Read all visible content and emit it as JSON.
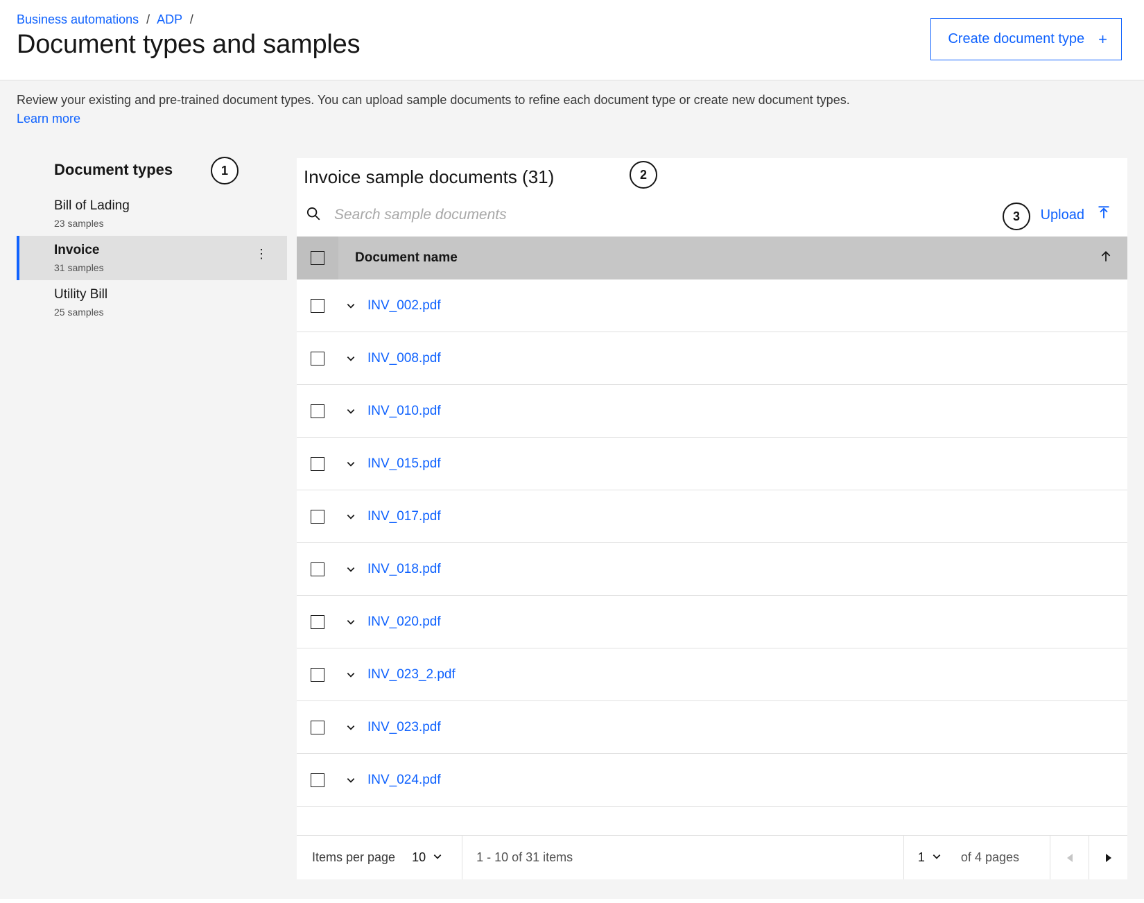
{
  "breadcrumb": {
    "item1": "Business automations",
    "item2": "ADP"
  },
  "pageTitle": "Document types and samples",
  "createButton": "Create document type",
  "intro": {
    "text": "Review your existing and pre-trained document types. You can upload sample documents to refine each document type or create new document types.",
    "learn": "Learn more"
  },
  "sidebar": {
    "title": "Document types",
    "items": [
      {
        "name": "Bill of Lading",
        "count": "23 samples"
      },
      {
        "name": "Invoice",
        "count": "31 samples"
      },
      {
        "name": "Utility Bill",
        "count": "25 samples"
      }
    ]
  },
  "main": {
    "title": "Invoice sample documents (31)",
    "searchPlaceholder": "Search sample documents",
    "upload": "Upload",
    "columnName": "Document name",
    "rows": [
      "INV_002.pdf",
      "INV_008.pdf",
      "INV_010.pdf",
      "INV_015.pdf",
      "INV_017.pdf",
      "INV_018.pdf",
      "INV_020.pdf",
      "INV_023_2.pdf",
      "INV_023.pdf",
      "INV_024.pdf"
    ]
  },
  "pagination": {
    "itemsPerPageLabel": "Items per page",
    "itemsPerPageValue": "10",
    "range": "1 - 10 of 31 items",
    "currentPage": "1",
    "pagesText": "of 4 pages"
  },
  "annotations": {
    "a1": "1",
    "a2": "2",
    "a3": "3"
  }
}
